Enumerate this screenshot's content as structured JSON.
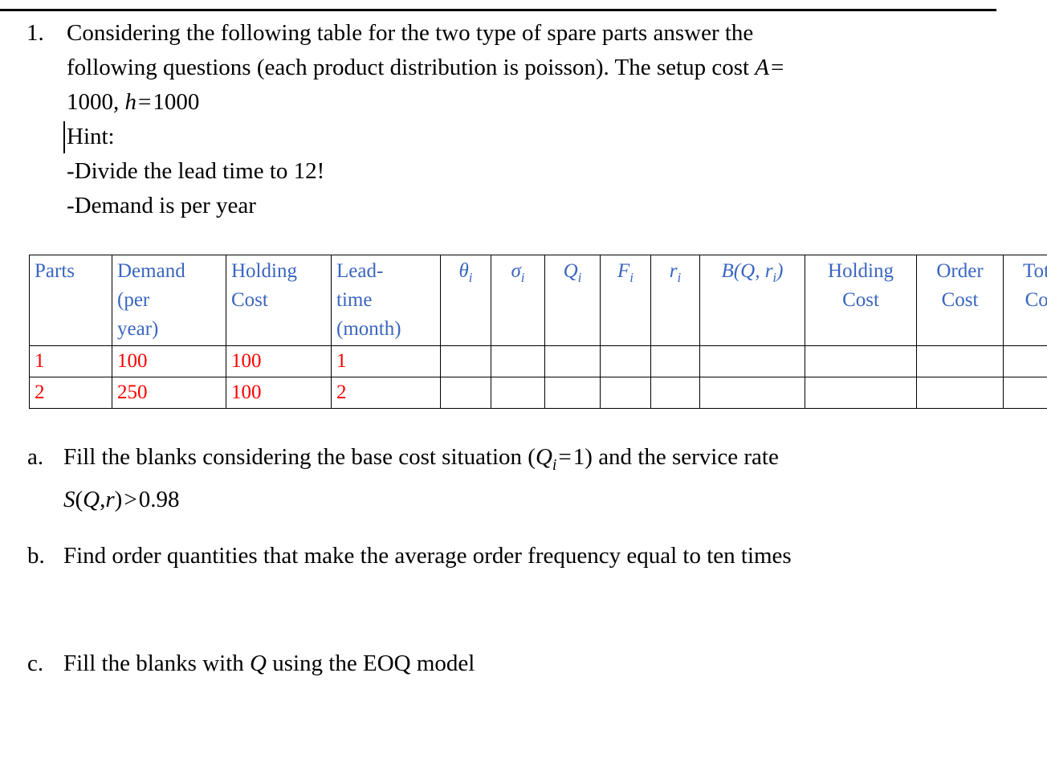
{
  "document": {
    "top_rule": true
  },
  "question1": {
    "number": "1.",
    "line1": "Considering the following table for the two type of spare parts answer the",
    "line2_pre": "following questions (each product distribution is poisson). The setup cost ",
    "line2_var": "A",
    "line2_eq": "=",
    "line3_num": "1000,",
    "line3_var": "h",
    "line3_eq": "=",
    "line3_val": "1000",
    "hint_label": "Hint:",
    "hint_1": "-Divide the lead time to 12!",
    "hint_2": "-Demand is per year"
  },
  "table": {
    "headers": [
      {
        "text": "Parts",
        "align": "left",
        "math": false
      },
      {
        "text": "Demand (per year)",
        "align": "left",
        "math": false
      },
      {
        "text": "Holding Cost",
        "align": "left",
        "math": false
      },
      {
        "text": "Lead-time (month)",
        "align": "left",
        "math": false
      },
      {
        "text": "θi",
        "align": "center",
        "math": true
      },
      {
        "text": "σi",
        "align": "center",
        "math": true
      },
      {
        "text": "Qi",
        "align": "center",
        "math": true
      },
      {
        "text": "Fi",
        "align": "center",
        "math": true
      },
      {
        "text": "ri",
        "align": "center",
        "math": true
      },
      {
        "text": "B(Q,ri)",
        "align": "center",
        "math": true
      },
      {
        "text": "Holding Cost",
        "align": "center",
        "math": false
      },
      {
        "text": "Order Cost",
        "align": "center",
        "math": false
      },
      {
        "text": "Total Cost",
        "align": "center",
        "math": false
      }
    ],
    "header_parts": "Parts",
    "header_demand_l1": "Demand",
    "header_demand_l2": "(per",
    "header_demand_l3": "year)",
    "header_holding_l1": "Holding",
    "header_holding_l2": "Cost",
    "header_lead_l1": "Lead-",
    "header_lead_l2": "time",
    "header_lead_l3": "(month)",
    "header_theta": "θ",
    "header_sigma": "σ",
    "header_qi": "Q",
    "header_fi": "F",
    "header_ri": "r",
    "header_sub_i": "i",
    "header_b_open": "B(",
    "header_b_q": "Q",
    "header_b_comma": ", ",
    "header_b_r": "r",
    "header_b_close": ")",
    "header_hc_l1": "Holding",
    "header_hc_l2": "Cost",
    "header_oc_l1": "Order",
    "header_oc_l2": "Cost",
    "header_tc_l1": "Total",
    "header_tc_l2": "Cost",
    "rows": [
      {
        "parts": "1",
        "demand": "100",
        "holding_cost": "100",
        "lead_time": "1",
        "theta": "",
        "sigma": "",
        "q": "",
        "f": "",
        "r": "",
        "b": "",
        "holding_cost_out": "",
        "order_cost": "",
        "total_cost": ""
      },
      {
        "parts": "2",
        "demand": "250",
        "holding_cost": "100",
        "lead_time": "2",
        "theta": "",
        "sigma": "",
        "q": "",
        "f": "",
        "r": "",
        "b": "",
        "holding_cost_out": "",
        "order_cost": "",
        "total_cost": ""
      }
    ],
    "header_color": "#3A66C0",
    "value_color": "#FF0000",
    "border_color": "#000000"
  },
  "subquestions": {
    "a": {
      "letter": "a.",
      "text_pre": "Fill the blanks considering the base cost situation (",
      "math_q": "Q",
      "math_sub": "i",
      "math_eq": "=",
      "math_val": "1)",
      "text_post": " and the service rate",
      "line2_s": "S",
      "line2_paren_open": "(",
      "line2_q": "Q",
      "line2_comma": ",",
      "line2_r": "r",
      "line2_paren_close": ")",
      "line2_gt": ">",
      "line2_val": "0.98"
    },
    "b": {
      "letter": "b.",
      "text": "Find order quantities that make the average order frequency equal to ten times"
    },
    "c": {
      "letter": "c.",
      "text_pre": "Fill the blanks with ",
      "math_q": "Q",
      "text_post": " using the EOQ model"
    }
  }
}
